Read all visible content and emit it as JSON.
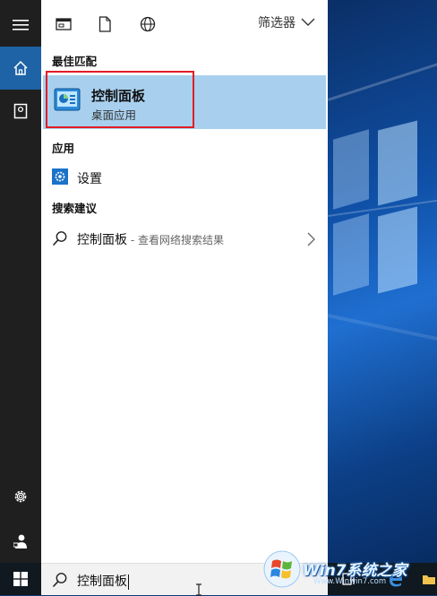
{
  "topbar": {
    "filter_label": "筛选器"
  },
  "sections": {
    "best_match": "最佳匹配",
    "apps": "应用",
    "suggestions": "搜索建议"
  },
  "best_match": {
    "title": "控制面板",
    "subtitle": "桌面应用",
    "highlight_color": "#e21c24"
  },
  "apps": [
    {
      "label": "设置",
      "icon": "gear-icon"
    }
  ],
  "suggestions": [
    {
      "query": "控制面板",
      "hint": " - 查看网络搜索结果"
    }
  ],
  "search": {
    "value": "控制面板"
  },
  "watermark": {
    "text": "Win7系统之家",
    "url": "Www.Winwin7.com"
  },
  "colors": {
    "accent": "#1d63a5",
    "selection": "#a8d0ee"
  }
}
